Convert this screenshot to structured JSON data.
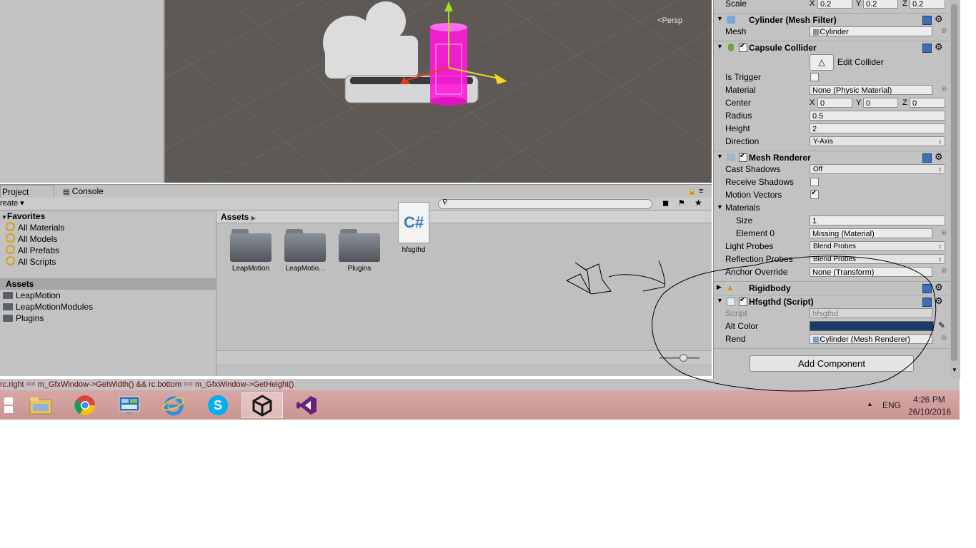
{
  "scene": {
    "persp_label": "Persp"
  },
  "project": {
    "tab_project": "Project",
    "tab_console": "Console",
    "create_label": "reate",
    "favorites": {
      "title": "Favorites",
      "items": [
        "All Materials",
        "All Models",
        "All Prefabs",
        "All Scripts"
      ]
    },
    "assets_tree": {
      "title": "Assets",
      "items": [
        "LeapMotion",
        "LeapMotionModules",
        "Plugins"
      ]
    },
    "breadcrumb": "Assets",
    "grid_items": [
      {
        "label": "LeapMotion",
        "type": "folder"
      },
      {
        "label": "LeapMotio...",
        "type": "folder"
      },
      {
        "label": "Plugins",
        "type": "folder"
      },
      {
        "label": "hfsgthd",
        "type": "script",
        "glyph": "C#"
      }
    ]
  },
  "status_text": "rc.right == m_GfxWindow->GetWidth() && rc.bottom == m_GfxWindow->GetHeight()",
  "inspector": {
    "scale": {
      "label": "Scale",
      "x": "0.2",
      "y": "0.2",
      "z": "0.2"
    },
    "mesh_filter": {
      "title": "Cylinder (Mesh Filter)",
      "mesh_label": "Mesh",
      "mesh_value": "Cylinder"
    },
    "capsule_collider": {
      "title": "Capsule Collider",
      "edit_collider": "Edit Collider",
      "is_trigger_label": "Is Trigger",
      "material_label": "Material",
      "material_value": "None (Physic Material)",
      "center_label": "Center",
      "center": {
        "x": "0",
        "y": "0",
        "z": "0"
      },
      "radius_label": "Radius",
      "radius_value": "0.5",
      "height_label": "Height",
      "height_value": "2",
      "direction_label": "Direction",
      "direction_value": "Y-Axis"
    },
    "mesh_renderer": {
      "title": "Mesh Renderer",
      "cast_shadows_label": "Cast Shadows",
      "cast_shadows_value": "Off",
      "receive_shadows_label": "Receive Shadows",
      "receive_shadows": false,
      "motion_vectors_label": "Motion Vectors",
      "motion_vectors": true,
      "materials_label": "Materials",
      "size_label": "Size",
      "size_value": "1",
      "element0_label": "Element 0",
      "element0_value": "Missing (Material)",
      "light_probes_label": "Light Probes",
      "light_probes_value": "Blend Probes",
      "reflection_probes_label": "Reflection Probes",
      "reflection_probes_value": "Blend Probes",
      "anchor_override_label": "Anchor Override",
      "anchor_override_value": "None (Transform)"
    },
    "rigidbody": {
      "title": "Rigidbody"
    },
    "script": {
      "title": "Hfsgthd (Script)",
      "script_label": "Script",
      "script_value": "hfsgthd",
      "alt_color_label": "Alt Color",
      "alt_color": "#1b3a6b",
      "rend_label": "Rend",
      "rend_value": "Cylinder (Mesh Renderer)"
    },
    "add_component": "Add Component"
  },
  "taskbar": {
    "apps": [
      "windows-start",
      "file-explorer",
      "chrome",
      "control-panel",
      "internet-explorer",
      "skype",
      "unity",
      "visual-studio"
    ],
    "language": "ENG",
    "time": "4:26 PM",
    "date": "26/10/2016"
  },
  "colors": {
    "accent_magenta": "#ff1ad9",
    "taskbar": "#d3a19e",
    "editor_gray": "#c2c2c2"
  }
}
